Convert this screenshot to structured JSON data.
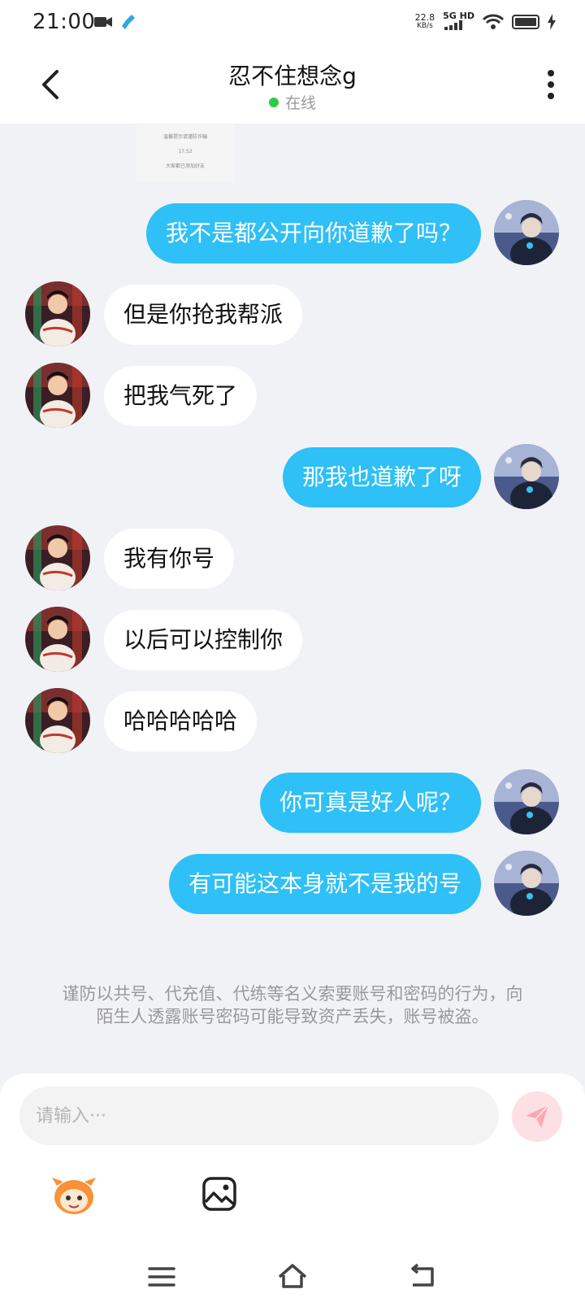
{
  "status_bar": {
    "time": "21:00",
    "speed_value": "22.8",
    "speed_unit": "KB/s",
    "network": "5G HD",
    "icons": [
      "video-icon",
      "cleaner-icon",
      "signal-icon",
      "wifi-icon",
      "battery-icon",
      "charging-icon"
    ]
  },
  "header": {
    "title": "忍不住想念g",
    "status": "在线",
    "status_color": "#2ecc40",
    "icons": [
      "back-icon",
      "more-icon"
    ]
  },
  "thumbnail": {
    "line1": "温馨提示请谨防诈骗",
    "line2": "17:52",
    "line3": "大家都已添加好友"
  },
  "messages": [
    {
      "from": "me",
      "text": "我不是都公开向你道歉了吗？"
    },
    {
      "from": "other",
      "text": "但是你抢我帮派"
    },
    {
      "from": "other",
      "text": "把我气死了"
    },
    {
      "from": "me",
      "text": "那我也道歉了呀"
    },
    {
      "from": "other",
      "text": "我有你号"
    },
    {
      "from": "other",
      "text": "以后可以控制你"
    },
    {
      "from": "other",
      "text": "哈哈哈哈哈"
    },
    {
      "from": "me",
      "text": "你可真是好人呢？"
    },
    {
      "from": "me",
      "text": "有可能这本身就不是我的号"
    }
  ],
  "notice": "谨防以共号、代充值、代练等名义索要账号和密码的行为，向陌生人透露账号密码可能导致资产丢失，账号被盗。",
  "input": {
    "placeholder": "请输入···",
    "value": ""
  },
  "toolbar": {
    "icons": [
      "emoji-icon",
      "image-icon",
      "send-icon"
    ]
  },
  "nav": {
    "icons": [
      "menu-icon",
      "home-icon",
      "back-nav-icon"
    ]
  },
  "colors": {
    "my_bubble": "#2ec0f6",
    "their_bubble": "#ffffff",
    "background": "#f1f2f6",
    "send_button": "#fde0e4"
  }
}
